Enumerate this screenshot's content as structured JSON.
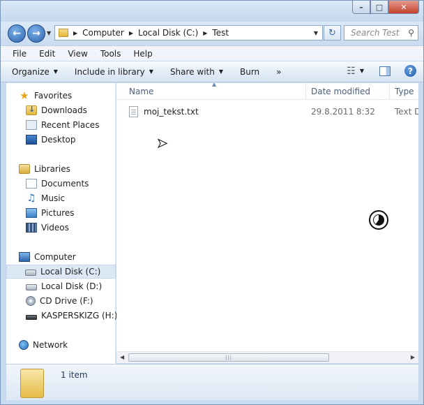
{
  "address": {
    "crumbs": [
      "Computer",
      "Local Disk (C:)",
      "Test"
    ],
    "search_placeholder": "Search Test"
  },
  "menubar": [
    "File",
    "Edit",
    "View",
    "Tools",
    "Help"
  ],
  "commands": {
    "organize": "Organize",
    "include_in_library": "Include in library",
    "share_with": "Share with",
    "burn": "Burn",
    "more": "»"
  },
  "nav": {
    "favorites": "Favorites",
    "downloads": "Downloads",
    "recent_places": "Recent Places",
    "desktop": "Desktop",
    "libraries": "Libraries",
    "documents": "Documents",
    "music": "Music",
    "pictures": "Pictures",
    "videos": "Videos",
    "computer": "Computer",
    "local_disk_c": "Local Disk (C:)",
    "local_disk_d": "Local Disk (D:)",
    "cd_drive": "CD Drive (F:)",
    "kaspersky": "KASPERSKIZG (H:)",
    "network": "Network"
  },
  "columns": {
    "name": "Name",
    "date_modified": "Date modified",
    "type": "Type"
  },
  "files": [
    {
      "name": "moj_tekst.txt",
      "date": "29.8.2011 8:32",
      "type": "Text Document"
    }
  ],
  "details": {
    "count": "1 item"
  }
}
